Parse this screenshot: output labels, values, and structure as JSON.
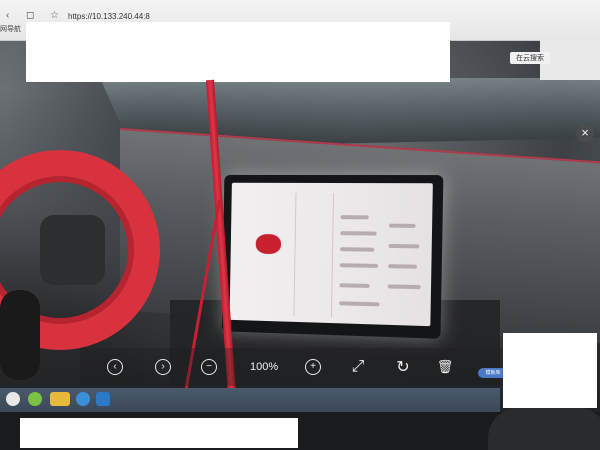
{
  "browser": {
    "address_text": "https://10.133.240.44:8",
    "favorites_label": "网导航",
    "search_engine_label": "在云搜索"
  },
  "viewer": {
    "zoom_label": "100%",
    "close_glyph": "×",
    "pill_label": "模板库"
  },
  "icons": {
    "prev": "‹",
    "next": "›",
    "zoom_out": "−",
    "zoom_in": "+",
    "fullscreen": "⤢",
    "rotate": "↻",
    "delete": "🗑"
  },
  "colors": {
    "wheel_red": "#d9323f",
    "string_red": "#c21d2f",
    "taskbar": "#3a4858",
    "accent_blue": "#4a79c9"
  }
}
